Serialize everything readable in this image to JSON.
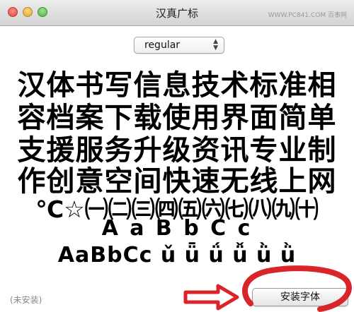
{
  "window": {
    "title": "汉真广标",
    "watermark": "WWW.PC841.COM 百事网"
  },
  "style_selector": {
    "value": "regular",
    "arrows": "▲▼"
  },
  "preview": {
    "lines": [
      "汉体书写信息技术标准相",
      "容档案下载使用界面简单",
      "支援服务升级资讯专业制",
      "作创意空间快速无线上网",
      "℃☆㈠㈡㈢㈣㈤㈥㈦㈧㈨㈩",
      "A a B b C c",
      "AaBbCc ǔ ǖ ǘ ǚ ǜ ǜ"
    ]
  },
  "footer": {
    "status": "(未安装)",
    "install_label": "安装字体"
  },
  "annotation": {
    "arrow_color": "#d9252a",
    "circle_color": "#d9252a"
  }
}
